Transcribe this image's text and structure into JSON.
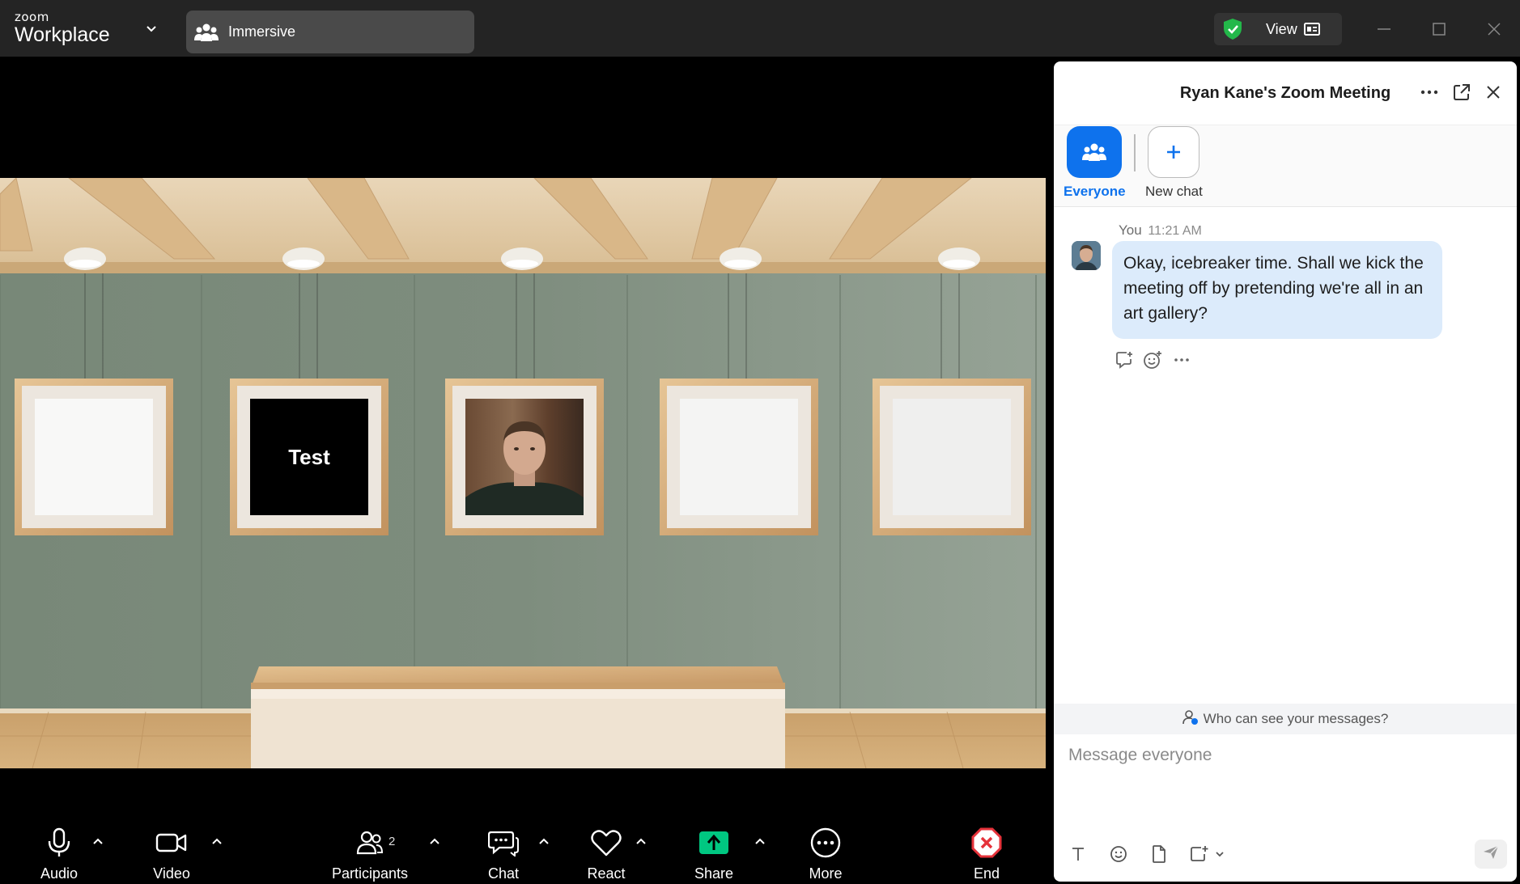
{
  "app": {
    "brand_small": "zoom",
    "brand_big": "Workplace"
  },
  "titlebar": {
    "view_mode": "Immersive",
    "view_button": "View"
  },
  "gallery": {
    "frames": [
      {
        "type": "empty"
      },
      {
        "type": "text",
        "label": "Test"
      },
      {
        "type": "photo"
      },
      {
        "type": "empty"
      },
      {
        "type": "empty"
      }
    ]
  },
  "toolbar": {
    "audio": "Audio",
    "video": "Video",
    "participants": "Participants",
    "participants_count": "2",
    "chat": "Chat",
    "react": "React",
    "share": "Share",
    "more": "More",
    "end": "End"
  },
  "chat": {
    "title": "Ryan Kane's Zoom Meeting",
    "recipients": [
      {
        "label": "Everyone",
        "selected": true
      },
      {
        "label": "New chat",
        "selected": false
      }
    ],
    "messages": [
      {
        "sender": "You",
        "time": "11:21 AM",
        "text": "Okay, icebreaker time. Shall we kick the meeting off by pretending we're all in an art gallery?"
      }
    ],
    "privacy_note": "Who can see your messages?",
    "input_placeholder": "Message everyone"
  },
  "colors": {
    "accent": "#0e72ed",
    "share_green": "#00c781",
    "end_red": "#e5323a",
    "bubble": "#dcebfb",
    "titlebar": "#242424"
  }
}
